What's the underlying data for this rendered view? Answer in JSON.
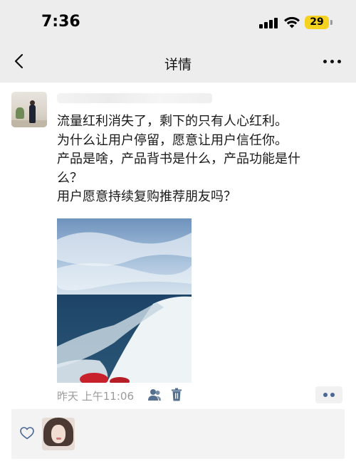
{
  "status_bar": {
    "time": "7:36",
    "battery": "29"
  },
  "nav": {
    "title": "详情"
  },
  "post": {
    "lines": [
      "流量红利消失了，剩下的只有人心红利。",
      "为什么让用户停留，愿意让用户信任你。",
      "产品是啥，产品背书是什么，产品功能是什",
      "么？",
      "用户愿意持续复购推荐朋友吗？"
    ],
    "timestamp": "昨天 上午11:06"
  },
  "colors": {
    "nav_bg": "#ededed",
    "link_blue": "#4a6795",
    "meta_gray": "#9b9b9b",
    "battery_yellow": "#f5d21f"
  },
  "icons": {
    "back": "chevron-left-icon",
    "more": "more-dots-icon",
    "privacy": "friends-icon",
    "delete": "trash-icon",
    "action": "more-dots-icon",
    "like": "heart-icon"
  }
}
